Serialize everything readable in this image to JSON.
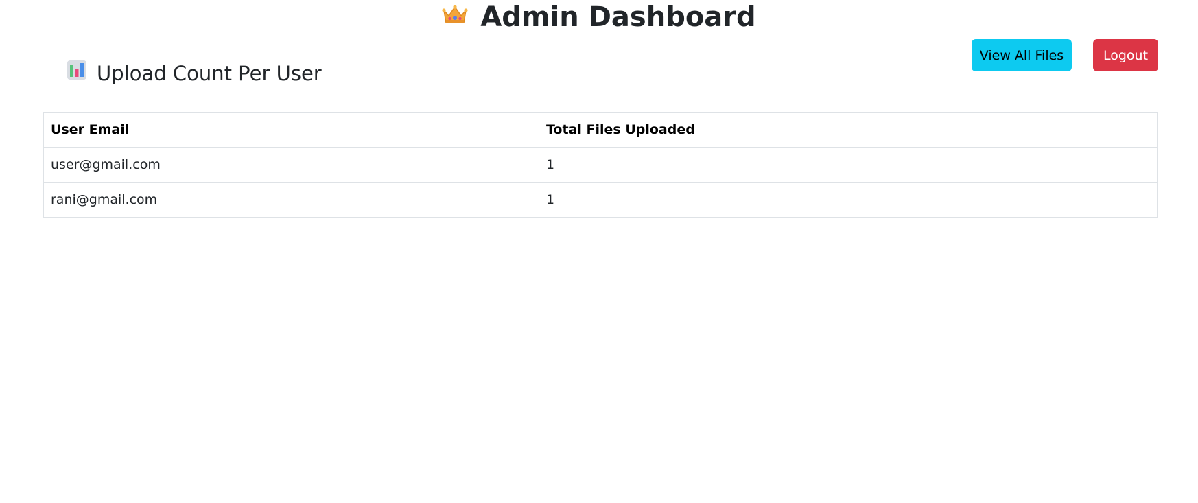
{
  "header": {
    "title": "Admin Dashboard",
    "icon": "crown-icon"
  },
  "section": {
    "title": "Upload Count Per User",
    "icon": "bar-chart-icon"
  },
  "actions": {
    "view_all_files_label": "View All Files",
    "logout_label": "Logout",
    "view_all_files_color": "#0dcaf0",
    "logout_color": "#dc3545"
  },
  "table": {
    "columns": [
      "User Email",
      "Total Files Uploaded"
    ],
    "rows": [
      [
        "user@gmail.com",
        "1"
      ],
      [
        "rani@gmail.com",
        "1"
      ]
    ]
  }
}
